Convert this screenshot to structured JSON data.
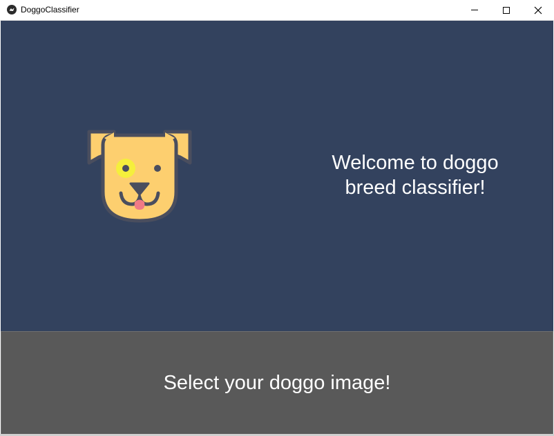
{
  "window": {
    "title": "DoggoClassifier",
    "app_icon": "kivy-logo-icon",
    "controls": {
      "minimize_icon": "minimize-icon",
      "maximize_icon": "maximize-icon",
      "close_icon": "close-icon"
    }
  },
  "main": {
    "logo_icon": "dog-face-icon",
    "welcome_line1": "Welcome to doggo",
    "welcome_line2": "breed classifier!"
  },
  "action": {
    "select_label": "Select your doggo image!"
  },
  "colors": {
    "background": "#33425e",
    "button": "#595959",
    "text": "#ffffff",
    "dog_face": "#fdcf6f",
    "dog_outline": "#4a4e5e",
    "tongue": "#f07a86",
    "eye_patch": "#f5ef3c"
  }
}
